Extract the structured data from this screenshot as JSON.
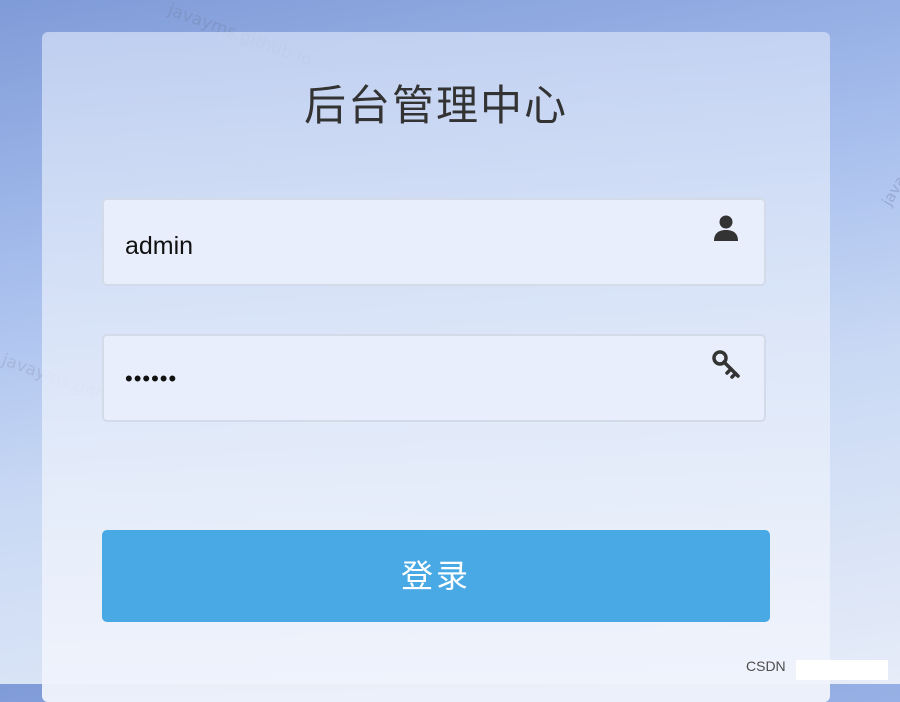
{
  "watermarks": [
    "javayms.github.io",
    "javayms.github.io",
    "java"
  ],
  "title": "后台管理中心",
  "username_field": {
    "value": "admin",
    "icon": "user-icon"
  },
  "password_field": {
    "value": "••••••",
    "icon": "key-icon"
  },
  "login_button": {
    "label": "登录",
    "color": "#49a9e5"
  },
  "footer": {
    "source_tag": "CSDN"
  }
}
